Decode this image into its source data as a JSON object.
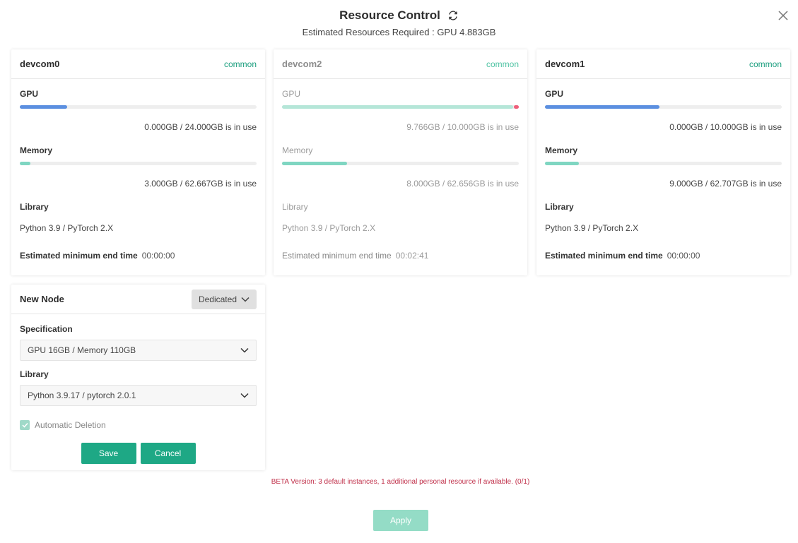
{
  "header": {
    "title": "Resource Control",
    "subtitle": "Estimated Resources Required : GPU 4.883GB"
  },
  "labels": {
    "gpu": "GPU",
    "memory": "Memory",
    "library": "Library",
    "end_time": "Estimated minimum end time"
  },
  "servers": [
    {
      "name": "devcom0",
      "tag": "common",
      "gpu_fill": 0.2,
      "gpu_usage": "0.000GB / 24.000GB is in use",
      "memory_fill": 0.045,
      "memory_usage": "3.000GB / 62.667GB is in use",
      "library": "Python 3.9  / PyTorch 2.X",
      "end_time": "00:00:00"
    },
    {
      "name": "devcom2",
      "tag": "common",
      "gpu_fill": 0.976,
      "gpu_usage": "9.766GB / 10.000GB is in use",
      "memory_fill": 0.275,
      "memory_usage": "8.000GB / 62.656GB is in use",
      "library": "Python 3.9   / PyTorch 2.X",
      "end_time": "00:02:41"
    },
    {
      "name": "devcom1",
      "tag": "common",
      "gpu_fill": 0.485,
      "gpu_usage": "0.000GB / 10.000GB is in use",
      "memory_fill": 0.143,
      "memory_usage": "9.000GB / 62.707GB is in use",
      "library": "Python 3.9  / PyTorch 2.X",
      "end_time": "00:00:00"
    }
  ],
  "new_node": {
    "title": "New Node",
    "type": "Dedicated",
    "spec_label": "Specification",
    "spec_value": "GPU 16GB / Memory 110GB",
    "library_label": "Library",
    "library_value": "Python 3.9.17 / pytorch 2.0.1",
    "auto_delete_label": "Automatic Deletion",
    "save": "Save",
    "cancel": "Cancel"
  },
  "beta_notice": "BETA Version: 3 default instances, 1 additional personal resource if available. (0/1)",
  "apply": "Apply",
  "colors": {
    "gpu_bar": "#5b8fe0",
    "gpu_bar_full": "#b5e6d8",
    "gpu_bar_end": "#ee5f7a",
    "memory_bar": "#7fd6c2",
    "accent": "#1ea885"
  }
}
